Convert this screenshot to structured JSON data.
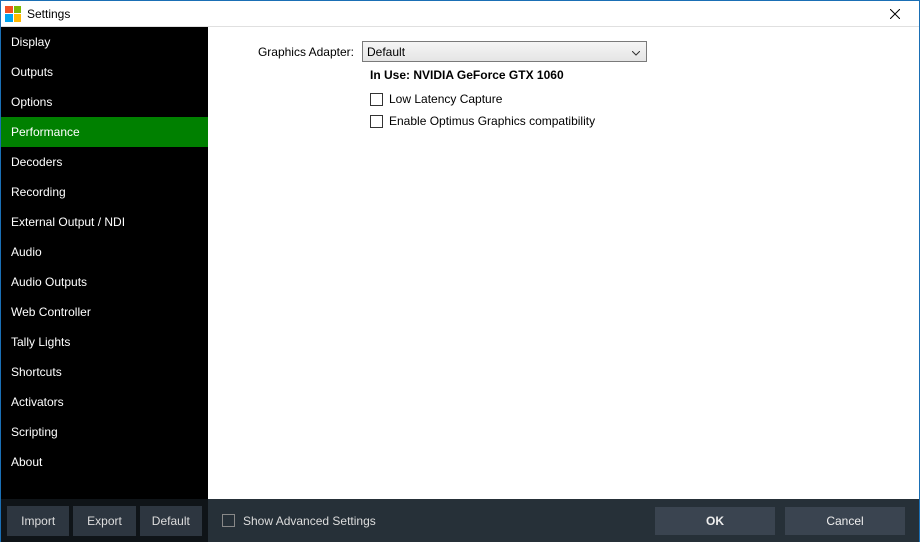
{
  "window": {
    "title": "Settings"
  },
  "sidebar": {
    "items": [
      {
        "label": "Display"
      },
      {
        "label": "Outputs"
      },
      {
        "label": "Options"
      },
      {
        "label": "Performance",
        "selected": true
      },
      {
        "label": "Decoders"
      },
      {
        "label": "Recording"
      },
      {
        "label": "External Output / NDI"
      },
      {
        "label": "Audio"
      },
      {
        "label": "Audio Outputs"
      },
      {
        "label": "Web Controller"
      },
      {
        "label": "Tally Lights"
      },
      {
        "label": "Shortcuts"
      },
      {
        "label": "Activators"
      },
      {
        "label": "Scripting"
      },
      {
        "label": "About"
      }
    ]
  },
  "main": {
    "graphics_adapter_label": "Graphics Adapter:",
    "graphics_adapter_value": "Default",
    "in_use_prefix": "In Use: ",
    "in_use_value": "NVIDIA GeForce GTX 1060",
    "low_latency_label": "Low Latency Capture",
    "low_latency_checked": false,
    "optimus_label": "Enable Optimus Graphics compatibility",
    "optimus_checked": false
  },
  "footer": {
    "import_label": "Import",
    "export_label": "Export",
    "default_label": "Default",
    "show_advanced_label": "Show Advanced Settings",
    "show_advanced_checked": false,
    "ok_label": "OK",
    "cancel_label": "Cancel"
  }
}
